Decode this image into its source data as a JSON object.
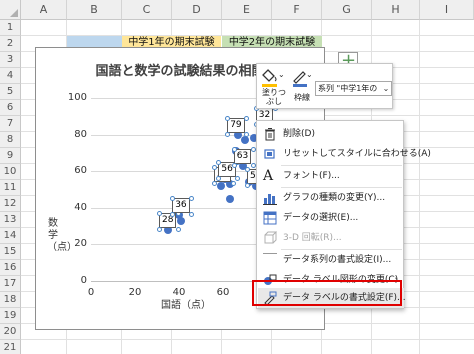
{
  "sheet": {
    "columns": [
      "A",
      "B",
      "C",
      "D",
      "E",
      "F",
      "G",
      "H",
      "I"
    ],
    "rows": [
      "1",
      "2",
      "3",
      "4",
      "5",
      "6",
      "7",
      "8",
      "9",
      "10",
      "11",
      "12",
      "13",
      "14",
      "15",
      "16",
      "17",
      "18",
      "19",
      "20",
      "21"
    ],
    "cells": {
      "c2": "中学1年の期末試験",
      "e2": "中学2年の期末試験"
    },
    "colors": {
      "header_b": "#bdd7ee",
      "header_c": "#ffe699",
      "header_e": "#c6e0b4",
      "grid": "#e1e1e1",
      "header_bg": "#efefef"
    }
  },
  "chart": {
    "plus_icon": "plus-icon"
  },
  "chart_data": {
    "type": "scatter",
    "title": "国語と数学の試験結果の相関",
    "xlabel": "国語（点）",
    "ylabel": "数学（点）",
    "xlim": [
      0,
      100
    ],
    "ylim": [
      0,
      100
    ],
    "x_ticks": [
      "0",
      "20",
      "40",
      "60",
      "80"
    ],
    "y_ticks": [
      "0",
      "20",
      "40",
      "60",
      "80",
      "100"
    ],
    "grid": true,
    "marker_color": "#4472c4",
    "points": [
      {
        "x": 35,
        "y": 28
      },
      {
        "x": 37,
        "y": 31
      },
      {
        "x": 40,
        "y": 36
      },
      {
        "x": 41,
        "y": 33
      },
      {
        "x": 59,
        "y": 52
      },
      {
        "x": 61,
        "y": 56
      },
      {
        "x": 63,
        "y": 53
      },
      {
        "x": 63,
        "y": 45
      },
      {
        "x": 66,
        "y": 71
      },
      {
        "x": 67,
        "y": 80
      },
      {
        "x": 68,
        "y": 67
      },
      {
        "x": 69,
        "y": 63
      },
      {
        "x": 70,
        "y": 77
      },
      {
        "x": 72,
        "y": 54
      },
      {
        "x": 74,
        "y": 78
      },
      {
        "x": 75,
        "y": 52
      },
      {
        "x": 77,
        "y": 82
      },
      {
        "x": 79,
        "y": 62
      }
    ],
    "data_labels": [
      {
        "text": "28",
        "x": 35,
        "y": 28
      },
      {
        "text": "36",
        "x": 41,
        "y": 36
      },
      {
        "text": "53",
        "x": 60,
        "y": 53
      },
      {
        "text": "56",
        "x": 62,
        "y": 56
      },
      {
        "text": "79",
        "x": 66,
        "y": 80
      },
      {
        "text": "63",
        "x": 69,
        "y": 63
      },
      {
        "text": "52",
        "x": 75,
        "y": 52
      },
      {
        "text": "32",
        "x": 79,
        "y": 85
      }
    ]
  },
  "mini_toolbar": {
    "fill_label_1": "塗りつ",
    "fill_label_2": "ぶし",
    "outline_label": "枠線",
    "series_select": "系列 \"中学1年の",
    "fill_color": "#ffc000",
    "outline_color": "#4472c4"
  },
  "context_menu": {
    "items": [
      {
        "label": "削除(D)",
        "icon": "delete-icon"
      },
      {
        "label": "リセットしてスタイルに合わせる(A)",
        "icon": "reset-style-icon"
      },
      {
        "label": "フォント(F)...",
        "icon": "font-icon"
      },
      {
        "label": "グラフの種類の変更(Y)...",
        "icon": "chart-type-icon"
      },
      {
        "label": "データの選択(E)...",
        "icon": "select-data-icon"
      },
      {
        "label": "3-D 回転(R)...",
        "icon": "rotate-3d-icon"
      },
      {
        "label": "データ系列の書式設定(I)...",
        "icon": "series-format-icon"
      },
      {
        "label": "データ ラベル図形の変更(C)",
        "icon": "label-shape-icon"
      },
      {
        "label": "データ ラベルの書式設定(F)...",
        "icon": "label-format-icon"
      }
    ],
    "highlight_color": "#e00000"
  }
}
